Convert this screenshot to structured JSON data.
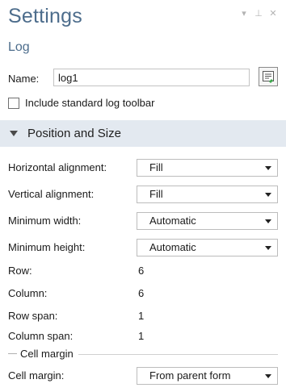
{
  "header": {
    "title": "Settings",
    "subtitle": "Log",
    "controls": [
      "chevron-down-icon",
      "pin-icon",
      "close-icon"
    ]
  },
  "name_field": {
    "label": "Name:",
    "value": "log1",
    "button_icon": "edit-name-icon"
  },
  "checkbox": {
    "label": "Include standard log toolbar",
    "checked": false
  },
  "section": {
    "title": "Position and Size",
    "expanded": true
  },
  "properties": {
    "horizontal_alignment": {
      "label": "Horizontal alignment:",
      "value": "Fill"
    },
    "vertical_alignment": {
      "label": "Vertical alignment:",
      "value": "Fill"
    },
    "minimum_width": {
      "label": "Minimum width:",
      "value": "Automatic"
    },
    "minimum_height": {
      "label": "Minimum height:",
      "value": "Automatic"
    },
    "row": {
      "label": "Row:",
      "value": "6"
    },
    "column": {
      "label": "Column:",
      "value": "6"
    },
    "row_span": {
      "label": "Row span:",
      "value": "1"
    },
    "column_span": {
      "label": "Column span:",
      "value": "1"
    }
  },
  "cell_margin_group": {
    "group_label": "Cell margin",
    "label": "Cell margin:",
    "value": "From parent form"
  },
  "colors": {
    "title": "#4d6d8c",
    "section_bg": "#e3e9f0"
  }
}
